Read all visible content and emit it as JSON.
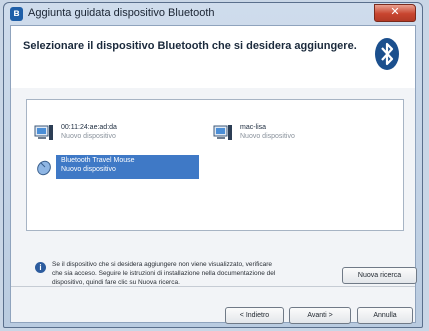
{
  "window": {
    "title": "Aggiunta guidata dispositivo Bluetooth"
  },
  "header": {
    "instruction": "Selezionare il dispositivo Bluetooth che si desidera aggiungere."
  },
  "devices": [
    {
      "name": "00:11:24:ae:ad:da",
      "status": "Nuovo dispositivo",
      "icon": "computer-icon",
      "selected": false
    },
    {
      "name": "mac-lisa",
      "status": "Nuovo dispositivo",
      "icon": "computer-icon",
      "selected": false
    },
    {
      "name": "Bluetooth Travel Mouse",
      "status": "Nuovo dispositivo",
      "icon": "mouse-icon",
      "selected": true
    }
  ],
  "info": {
    "text": "Se il dispositivo che si desidera aggiungere non viene visualizzato, verificare che sia acceso. Seguire le istruzioni di installazione nella documentazione del dispositivo, quindi fare clic su Nuova ricerca."
  },
  "buttons": {
    "search": "Nuova ricerca",
    "back": "< Indietro",
    "next": "Avanti >",
    "cancel": "Annulla"
  },
  "colors": {
    "selection": "#3f79c6",
    "bluetooth_brand": "#1b4f8d"
  }
}
